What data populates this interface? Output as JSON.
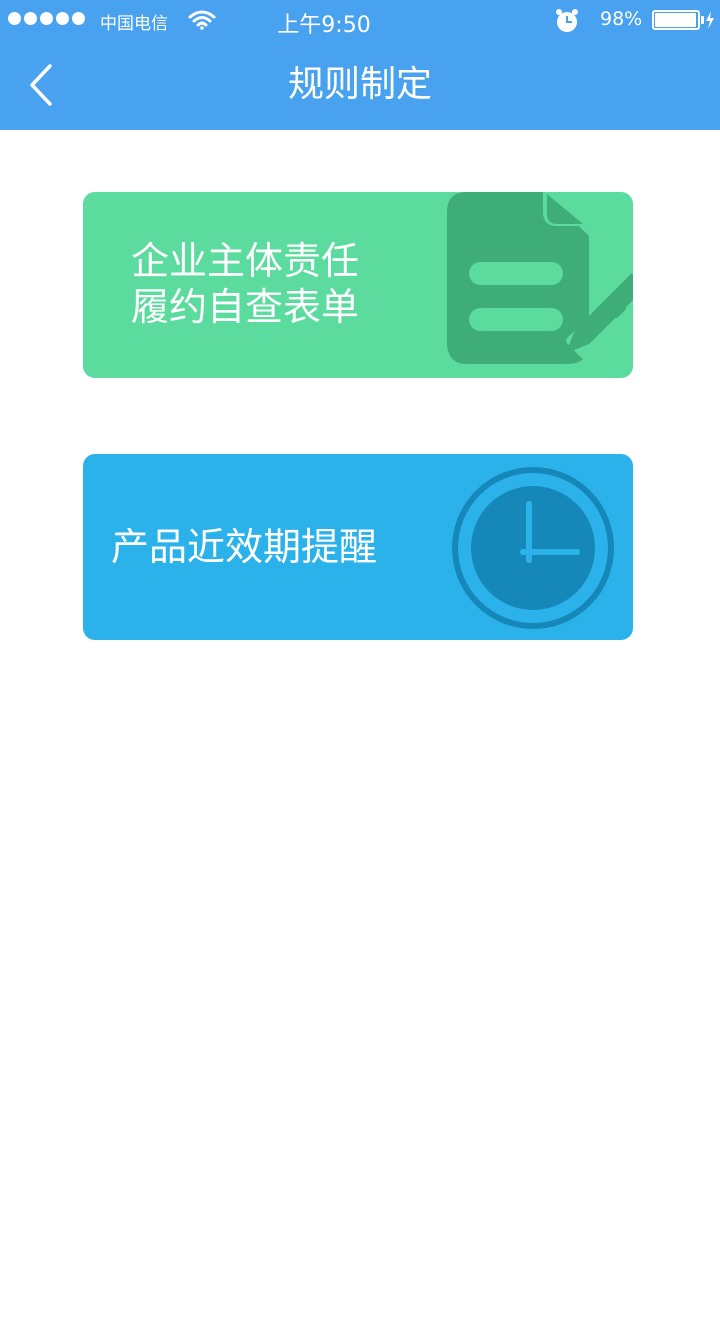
{
  "status_bar": {
    "carrier": "中国电信",
    "time": "上午9:50",
    "battery_percent_text": "98%",
    "battery_level": 0.98,
    "icons": [
      "signal-dots-icon",
      "wifi-icon",
      "alarm-icon",
      "battery-icon",
      "charging-bolt-icon"
    ]
  },
  "nav": {
    "title": "规则制定",
    "back_icon": "chevron-left-icon"
  },
  "cards": [
    {
      "line1": "企业主体责任",
      "line2": "履约自查表单",
      "icon": "document-edit-icon",
      "color": "#5cdb9e",
      "icon_color": "#3fad78"
    },
    {
      "label": "产品近效期提醒",
      "icon": "clock-icon",
      "color": "#2bb2ea",
      "icon_color": "#1587b8"
    }
  ],
  "colors": {
    "header": "#48a2ef",
    "background": "#ffffff"
  }
}
